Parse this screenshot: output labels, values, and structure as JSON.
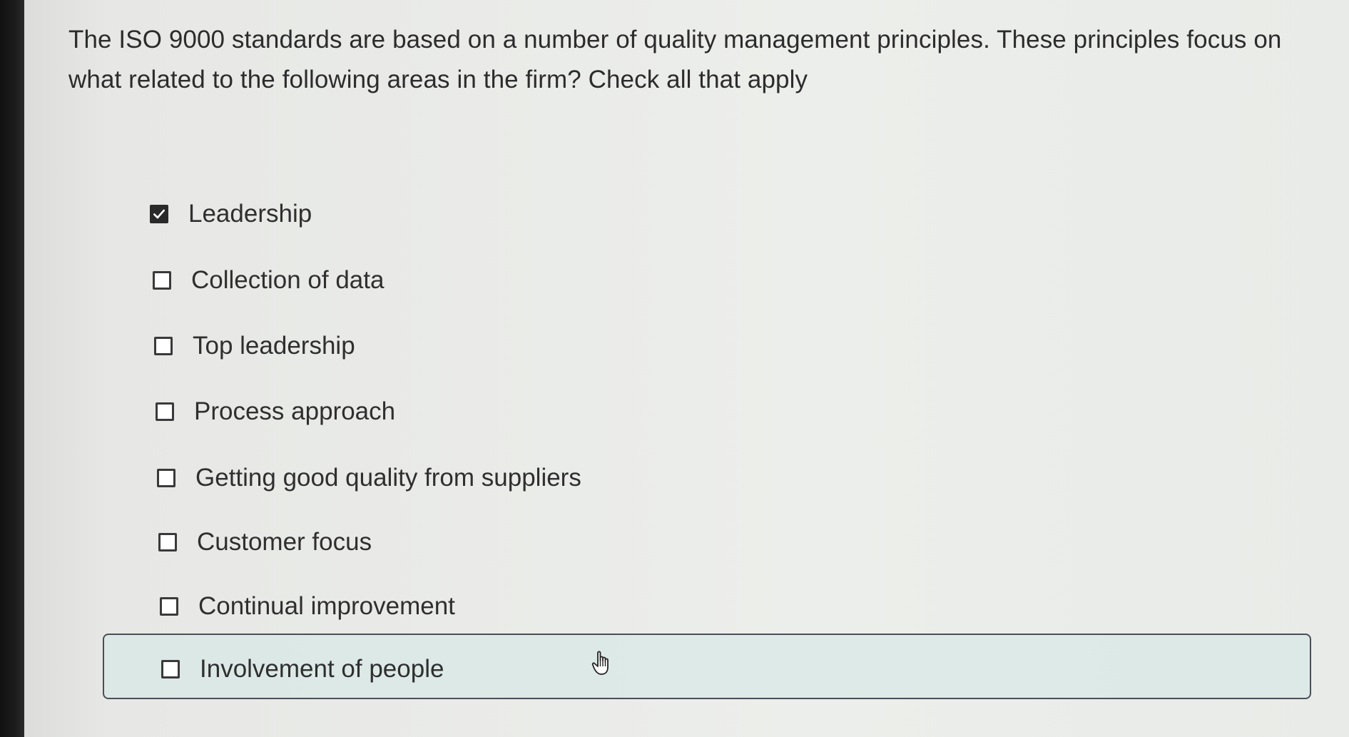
{
  "question": {
    "text": "The ISO 9000 standards are based on a number of quality management principles. These principles focus on what related to the following areas in the firm? Check all that apply"
  },
  "options": [
    {
      "label": "Leadership",
      "checked": true
    },
    {
      "label": "Collection of data",
      "checked": false
    },
    {
      "label": "Top leadership",
      "checked": false
    },
    {
      "label": "Process approach",
      "checked": false
    },
    {
      "label": "Getting good quality from suppliers",
      "checked": false
    },
    {
      "label": "Customer focus",
      "checked": false
    },
    {
      "label": "Continual improvement",
      "checked": false
    },
    {
      "label": "Involvement of people",
      "checked": false
    }
  ],
  "hovered_option": "Involvement of people",
  "icons": {
    "checked": "checkmark-icon",
    "cursor": "hand-pointer-icon"
  },
  "colors": {
    "checked_fill": "#2a2a2a",
    "hover_background": "#d2e8e6"
  }
}
